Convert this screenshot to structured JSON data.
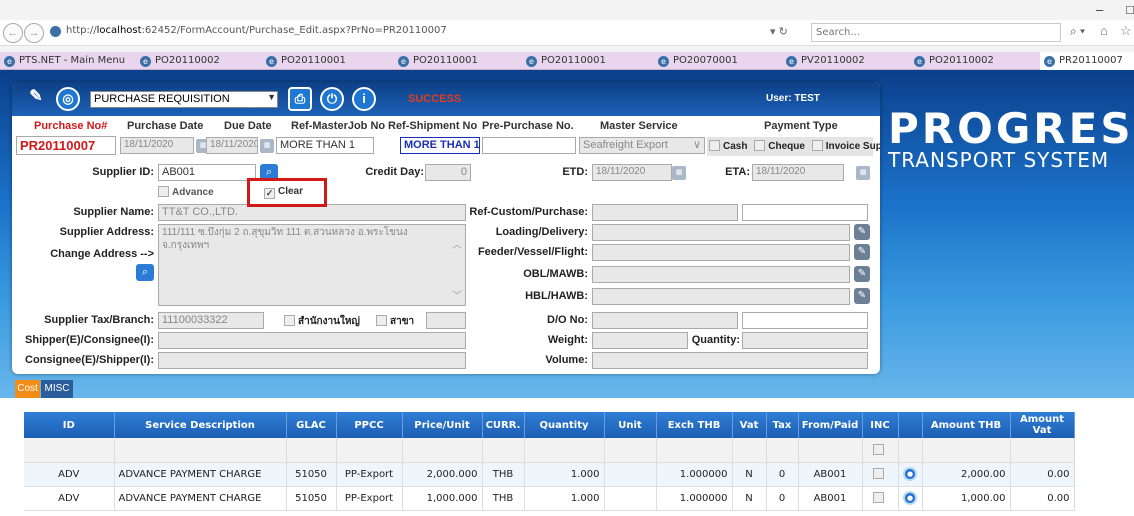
{
  "browser": {
    "url_prefix": "http://",
    "url_host": "localhost",
    "url_rest": ":62452/FormAccount/Purchase_Edit.aspx?PrNo=PR20110007",
    "search_placeholder": "Search...",
    "tabs": [
      "PTS.NET - Main Menu",
      "PO20110002",
      "PO20110001",
      "PO20110001",
      "PO20110001",
      "PO20070001",
      "PV20110002",
      "PO20110002",
      "PR20110007"
    ]
  },
  "toolbar": {
    "module": "PURCHASE REQUISITION",
    "status": "SUCCESS",
    "user": "User: TEST"
  },
  "brand": {
    "title": "PROGRESS",
    "subtitle": "TRANSPORT SYSTEM"
  },
  "header": {
    "labels": [
      "Purchase No#",
      "Purchase Date",
      "Due Date",
      "Ref-MasterJob No",
      "Ref-Shipment No",
      "Pre-Purchase No.",
      "Master Service",
      "Payment Type"
    ],
    "purchase_no": "PR20110007",
    "purchase_date": "18/11/2020",
    "due_date": "18/11/2020",
    "ref_master_job": "MORE THAN 1",
    "ref_shipment": "MORE THAN 1",
    "pre_purchase": "",
    "master_service": "Seafreight Export",
    "pay_cash": "Cash",
    "pay_cheque": "Cheque",
    "pay_invoice": "Invoice Sup"
  },
  "supplier": {
    "id_label": "Supplier ID:",
    "id": "AB001",
    "credit_label": "Credit Day:",
    "credit": "0",
    "etd_label": "ETD:",
    "etd": "18/11/2020",
    "eta_label": "ETA:",
    "eta": "18/11/2020",
    "advance": "Advance",
    "clear": "Clear",
    "name_label": "Supplier  Name:",
    "name": "TT&T CO.,LTD.",
    "address_label": "Supplier Address:",
    "address": "111/111 ซ.บึงกุ่ม 2 ถ.สุขุมวิท 111 ต.สวนหลวง อ.พระโขนง จ.กรุงเทพฯ",
    "change_address": "Change Address -->",
    "tax_label": "Supplier Tax/Branch:",
    "tax": "11100033322",
    "head_office": "สำนักงานใหญ่",
    "branch": "สาขา",
    "shipper_label": "Shipper(E)/Consignee(I):",
    "consignee_label": "Consignee(E)/Shipper(I):"
  },
  "right_fields": {
    "ref_custom": "Ref-Custom/Purchase:",
    "loading": "Loading/Delivery:",
    "feeder": "Feeder/Vessel/Flight:",
    "obl": "OBL/MAWB:",
    "hbl": "HBL/HAWB:",
    "do_no": "D/O No:",
    "weight": "Weight:",
    "quantity": "Quantity:",
    "volume": "Volume:"
  },
  "subtabs": {
    "cost": "Cost",
    "misc": "MISC"
  },
  "grid": {
    "columns": [
      "ID",
      "Service Description",
      "GLAC",
      "PPCC",
      "Price/Unit",
      "CURR.",
      "Quantity",
      "Unit",
      "Exch THB",
      "Vat",
      "Tax",
      "From/Paid",
      "INC",
      "",
      "Amount THB",
      "Amount Vat"
    ],
    "rows": [
      [
        "ADV",
        "ADVANCE PAYMENT CHARGE",
        "51050",
        "PP-Export",
        "2,000.000",
        "THB",
        "1.000",
        "",
        "1.000000",
        "N",
        "0",
        "AB001",
        "",
        "",
        "2,000.00",
        "0.00"
      ],
      [
        "ADV",
        "ADVANCE PAYMENT CHARGE",
        "51050",
        "PP-Export",
        "1,000.000",
        "THB",
        "1.000",
        "",
        "1.000000",
        "N",
        "0",
        "AB001",
        "",
        "",
        "1,000.00",
        "0.00"
      ]
    ]
  }
}
